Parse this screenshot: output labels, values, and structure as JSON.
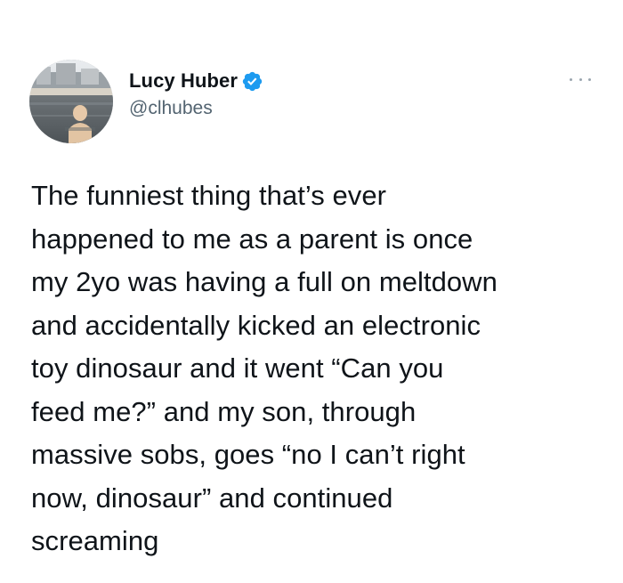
{
  "author": {
    "display_name": "Lucy Huber",
    "handle": "@clhubes",
    "verified": true
  },
  "tweet": {
    "text": "The funniest thing that’s ever\nhappened to me as a parent is once\nmy 2yo was having a full on meltdown\nand accidentally kicked an electronic\ntoy dinosaur and it went “Can you\nfeed me?” and my son, through\nmassive sobs, goes “no I can’t right\nnow, dinosaur” and continued\nscreaming"
  },
  "icons": {
    "verified": "verified-badge-icon",
    "more": "more-options-icon"
  },
  "colors": {
    "text_primary": "#0f1419",
    "text_secondary": "#536471",
    "verified_blue": "#1d9bf0",
    "background": "#ffffff"
  }
}
